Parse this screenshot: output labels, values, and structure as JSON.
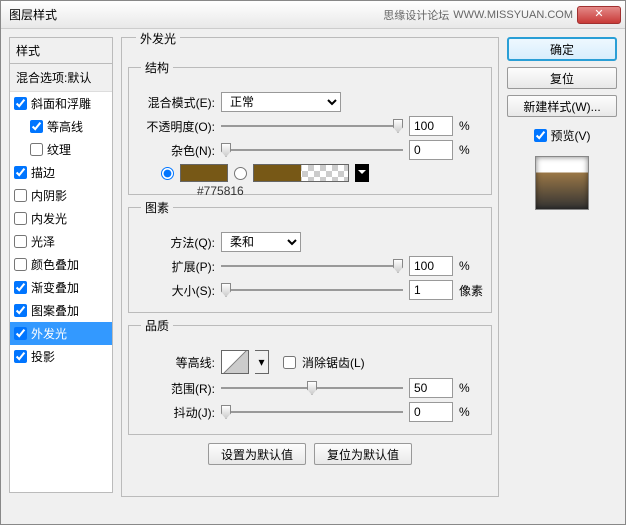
{
  "titlebar": {
    "title": "图层样式",
    "brand": "思缘设计论坛",
    "brand_url": "WWW.MISSYUAN.COM"
  },
  "styles": {
    "header": "样式",
    "blend": "混合选项:默认",
    "items": [
      {
        "label": "斜面和浮雕",
        "checked": true
      },
      {
        "label": "等高线",
        "checked": true,
        "indent": true
      },
      {
        "label": "纹理",
        "checked": false,
        "indent": true
      },
      {
        "label": "描边",
        "checked": true
      },
      {
        "label": "内阴影",
        "checked": false
      },
      {
        "label": "内发光",
        "checked": false
      },
      {
        "label": "光泽",
        "checked": false
      },
      {
        "label": "颜色叠加",
        "checked": false
      },
      {
        "label": "渐变叠加",
        "checked": true
      },
      {
        "label": "图案叠加",
        "checked": true
      },
      {
        "label": "外发光",
        "checked": true,
        "selected": true
      },
      {
        "label": "投影",
        "checked": true
      }
    ]
  },
  "main": {
    "title": "外发光",
    "structure": {
      "legend": "结构",
      "blend_mode_label": "混合模式(E):",
      "blend_mode_value": "正常",
      "opacity_label": "不透明度(O):",
      "opacity_value": "100",
      "opacity_unit": "%",
      "noise_label": "杂色(N):",
      "noise_value": "0",
      "noise_unit": "%",
      "color_hex": "#775816"
    },
    "elements": {
      "legend": "图素",
      "method_label": "方法(Q):",
      "method_value": "柔和",
      "spread_label": "扩展(P):",
      "spread_value": "100",
      "spread_unit": "%",
      "size_label": "大小(S):",
      "size_value": "1",
      "size_unit": "像素"
    },
    "quality": {
      "legend": "品质",
      "contour_label": "等高线:",
      "antialias_label": "消除锯齿(L)",
      "range_label": "范围(R):",
      "range_value": "50",
      "range_unit": "%",
      "jitter_label": "抖动(J):",
      "jitter_value": "0",
      "jitter_unit": "%"
    },
    "buttons": {
      "default": "设置为默认值",
      "reset": "复位为默认值"
    }
  },
  "right": {
    "ok": "确定",
    "cancel": "复位",
    "new_style": "新建样式(W)...",
    "preview": "预览(V)"
  }
}
